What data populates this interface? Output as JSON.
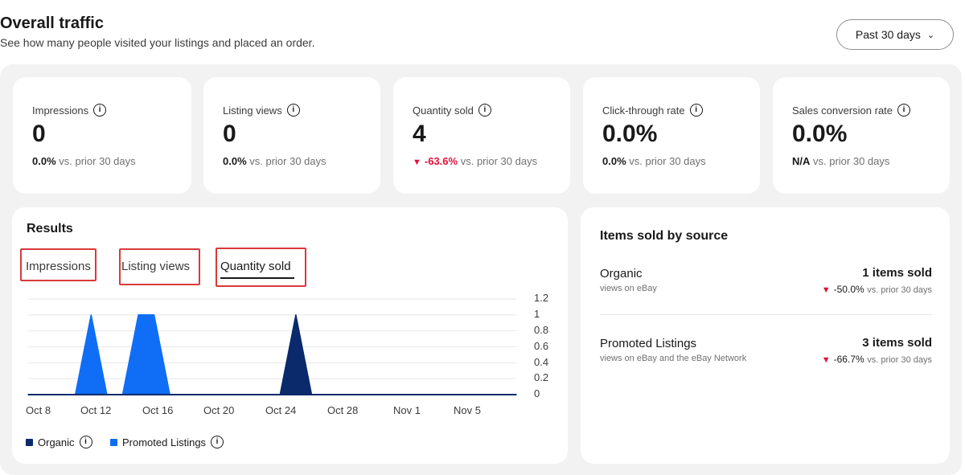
{
  "header": {
    "title": "Overall traffic",
    "subtitle": "See how many people visited your listings and placed an order.",
    "range_label": "Past 30 days"
  },
  "kpis": [
    {
      "label": "Impressions",
      "value": "0",
      "change": "0.0%",
      "suffix": "vs. prior 30 days"
    },
    {
      "label": "Listing views",
      "value": "0",
      "change": "0.0%",
      "suffix": "vs. prior 30 days"
    },
    {
      "label": "Quantity sold",
      "value": "4",
      "change": "-63.6%",
      "suffix": "vs. prior 30 days",
      "trend": "down"
    },
    {
      "label": "Click-through rate",
      "value": "0.0%",
      "change": "0.0%",
      "suffix": "vs. prior 30 days"
    },
    {
      "label": "Sales conversion rate",
      "value": "0.0%",
      "change": "N/A",
      "suffix": "vs. prior 30 days"
    }
  ],
  "results": {
    "title": "Results",
    "tabs": [
      "Impressions",
      "Listing views",
      "Quantity sold"
    ],
    "active_tab": "Quantity sold",
    "legend": [
      {
        "name": "Organic",
        "color": "#0a2a6b"
      },
      {
        "name": "Promoted Listings",
        "color": "#0f6ef5"
      }
    ]
  },
  "chart_data": {
    "type": "area",
    "x": [
      "Oct 7",
      "Oct 8",
      "Oct 9",
      "Oct 10",
      "Oct 11",
      "Oct 12",
      "Oct 13",
      "Oct 14",
      "Oct 15",
      "Oct 16",
      "Oct 17",
      "Oct 18",
      "Oct 19",
      "Oct 20",
      "Oct 21",
      "Oct 22",
      "Oct 23",
      "Oct 24",
      "Oct 25",
      "Oct 26",
      "Oct 27",
      "Oct 28",
      "Oct 29",
      "Oct 30",
      "Oct 31",
      "Nov 1",
      "Nov 2",
      "Nov 3",
      "Nov 4",
      "Nov 5",
      "Nov 6",
      "Nov 7"
    ],
    "x_tick_labels": [
      "Oct 8",
      "Oct 12",
      "Oct 16",
      "Oct 20",
      "Oct 24",
      "Oct 28",
      "Nov 1",
      "Nov 5"
    ],
    "y_tick_labels": [
      "0",
      "0.2",
      "0.4",
      "0.6",
      "0.8",
      "1",
      "1.2"
    ],
    "ylim": [
      0,
      1.2
    ],
    "series": [
      {
        "name": "Organic",
        "values": [
          0,
          0,
          0,
          0,
          0,
          0,
          0,
          0,
          0,
          0,
          0,
          0,
          0,
          0,
          0,
          0,
          0,
          1,
          0,
          0,
          0,
          0,
          0,
          0,
          0,
          0,
          0,
          0,
          0,
          0,
          0,
          0
        ]
      },
      {
        "name": "Promoted Listings",
        "values": [
          0,
          0,
          0,
          0,
          1,
          0,
          0,
          1,
          1,
          0,
          0,
          0,
          0,
          0,
          0,
          0,
          0,
          0,
          0,
          0,
          0,
          0,
          0,
          0,
          0,
          0,
          0,
          0,
          0,
          0,
          0,
          0
        ]
      }
    ],
    "y_axis_position": "right",
    "grid": true,
    "legend_position": "bottom-left"
  },
  "sources": {
    "title": "Items sold by source",
    "items": [
      {
        "name": "Organic",
        "sub": "views on eBay",
        "count": "1 items sold",
        "change": "-50.0%",
        "suffix": "vs. prior 30 days"
      },
      {
        "name": "Promoted Listings",
        "sub": "views on eBay and the eBay Network",
        "count": "3 items sold",
        "change": "-66.7%",
        "suffix": "vs. prior 30 days"
      }
    ]
  },
  "colors": {
    "organic": "#0a2a6b",
    "promoted": "#0f6ef5",
    "negative": "#e0103a",
    "highlight_box": "#d9393a"
  },
  "icons": [
    "info-icon",
    "chevron-down-icon",
    "down-triangle-icon"
  ]
}
